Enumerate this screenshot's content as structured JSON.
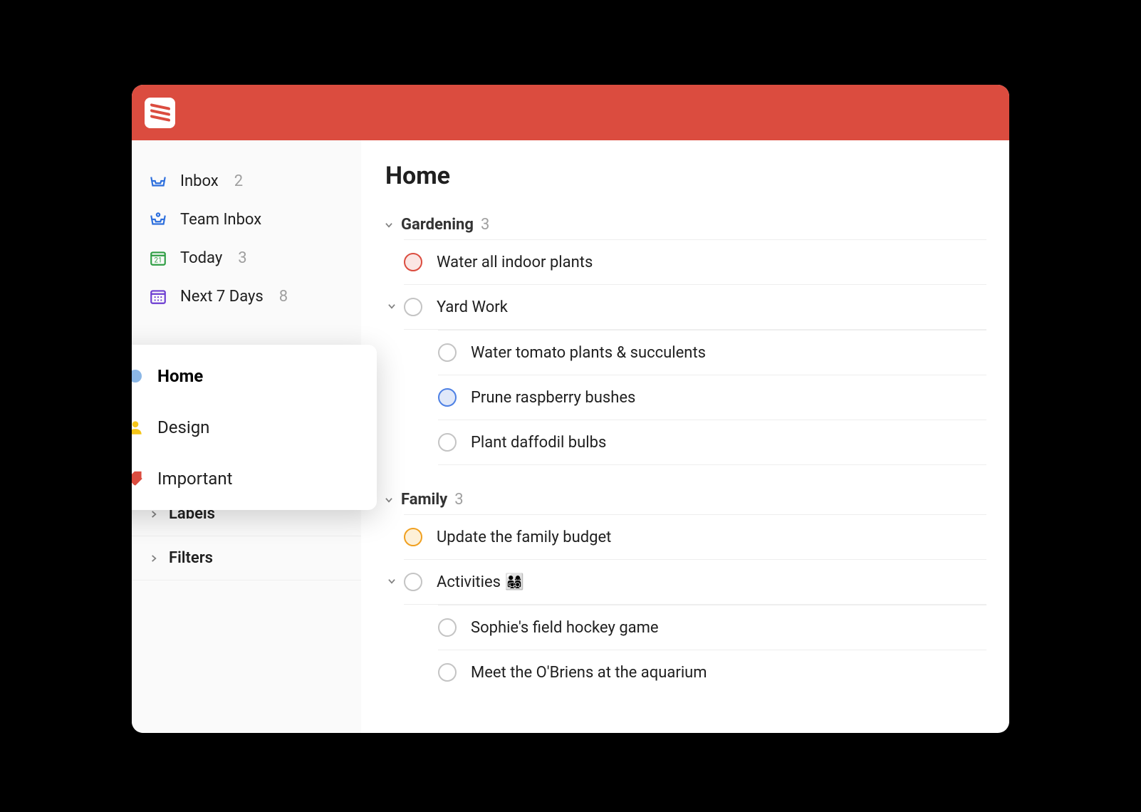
{
  "colors": {
    "brand": "#db4c3f",
    "inbox": "#2d6fdd",
    "today": "#2f9e44",
    "next7": "#6c3dd1",
    "orange": "#f0a020",
    "blue": "#4d80e4"
  },
  "sidebar": {
    "nav": [
      {
        "icon": "inbox-icon",
        "label": "Inbox",
        "count": "2"
      },
      {
        "icon": "team-inbox-icon",
        "label": "Team Inbox",
        "count": ""
      },
      {
        "icon": "calendar-today-icon",
        "label": "Today",
        "count": "3"
      },
      {
        "icon": "calendar-week-icon",
        "label": "Next 7 Days",
        "count": "8"
      }
    ],
    "sections": [
      {
        "label": "Labels"
      },
      {
        "label": "Filters"
      }
    ]
  },
  "popup": {
    "items": [
      {
        "icon": "dot",
        "label": "Home",
        "selected": true,
        "color": "#8bb7e6"
      },
      {
        "icon": "person",
        "label": "Design",
        "selected": false,
        "color": "#f5c518"
      },
      {
        "icon": "tag",
        "label": "Important",
        "selected": false,
        "color": "#db4c3f"
      }
    ]
  },
  "main": {
    "title": "Home",
    "sections": [
      {
        "name": "Gardening",
        "count": "3",
        "tasks": [
          {
            "label": "Water all indoor plants",
            "priority": "red",
            "subtasks": []
          },
          {
            "label": "Yard Work",
            "priority": "",
            "expandable": true,
            "subtasks": [
              {
                "label": "Water tomato plants & succulents",
                "priority": ""
              },
              {
                "label": "Prune raspberry bushes",
                "priority": "blue"
              },
              {
                "label": "Plant daffodil bulbs",
                "priority": ""
              }
            ]
          }
        ]
      },
      {
        "name": "Family",
        "count": "3",
        "tasks": [
          {
            "label": "Update the family budget",
            "priority": "orange",
            "subtasks": []
          },
          {
            "label": "Activities 👨‍👩‍👧‍👦",
            "priority": "",
            "expandable": true,
            "subtasks": [
              {
                "label": "Sophie's field hockey game",
                "priority": ""
              },
              {
                "label": "Meet the O'Briens at the aquarium",
                "priority": ""
              }
            ]
          }
        ]
      }
    ]
  }
}
